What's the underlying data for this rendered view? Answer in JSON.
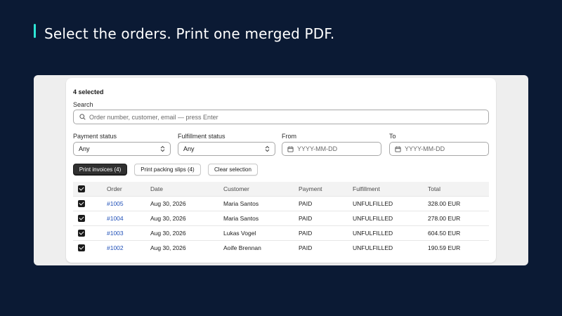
{
  "headline": "Select the orders. Print one merged PDF.",
  "colors": {
    "accent": "#2ee6d6",
    "background": "#0b1a34",
    "link": "#2050b8",
    "primary_button": "#303030"
  },
  "panel": {
    "selected_count": "4 selected",
    "search": {
      "label": "Search",
      "placeholder": "Order number, customer, email — press Enter",
      "value": "",
      "icon": "search-icon"
    },
    "filters": {
      "payment_status": {
        "label": "Payment status",
        "value": "Any"
      },
      "fulfillment_status": {
        "label": "Fulfillment status",
        "value": "Any"
      },
      "from": {
        "label": "From",
        "placeholder": "YYYY-MM-DD",
        "value": ""
      },
      "to": {
        "label": "To",
        "placeholder": "YYYY-MM-DD",
        "value": ""
      }
    },
    "actions": {
      "print_invoices": "Print invoices (4)",
      "print_packing_slips": "Print packing slips (4)",
      "clear_selection": "Clear selection"
    },
    "table": {
      "headers": [
        "Order",
        "Date",
        "Customer",
        "Payment",
        "Fulfillment",
        "Total"
      ],
      "header_checkbox_checked": true,
      "rows": [
        {
          "checked": true,
          "order": "#1005",
          "date": "Aug 30, 2026",
          "customer": "Maria Santos",
          "payment": "PAID",
          "fulfillment": "UNFULFILLED",
          "total": "328.00 EUR"
        },
        {
          "checked": true,
          "order": "#1004",
          "date": "Aug 30, 2026",
          "customer": "Maria Santos",
          "payment": "PAID",
          "fulfillment": "UNFULFILLED",
          "total": "278.00 EUR"
        },
        {
          "checked": true,
          "order": "#1003",
          "date": "Aug 30, 2026",
          "customer": "Lukas Vogel",
          "payment": "PAID",
          "fulfillment": "UNFULFILLED",
          "total": "604.50 EUR"
        },
        {
          "checked": true,
          "order": "#1002",
          "date": "Aug 30, 2026",
          "customer": "Aoife Brennan",
          "payment": "PAID",
          "fulfillment": "UNFULFILLED",
          "total": "190.59 EUR"
        }
      ]
    }
  }
}
